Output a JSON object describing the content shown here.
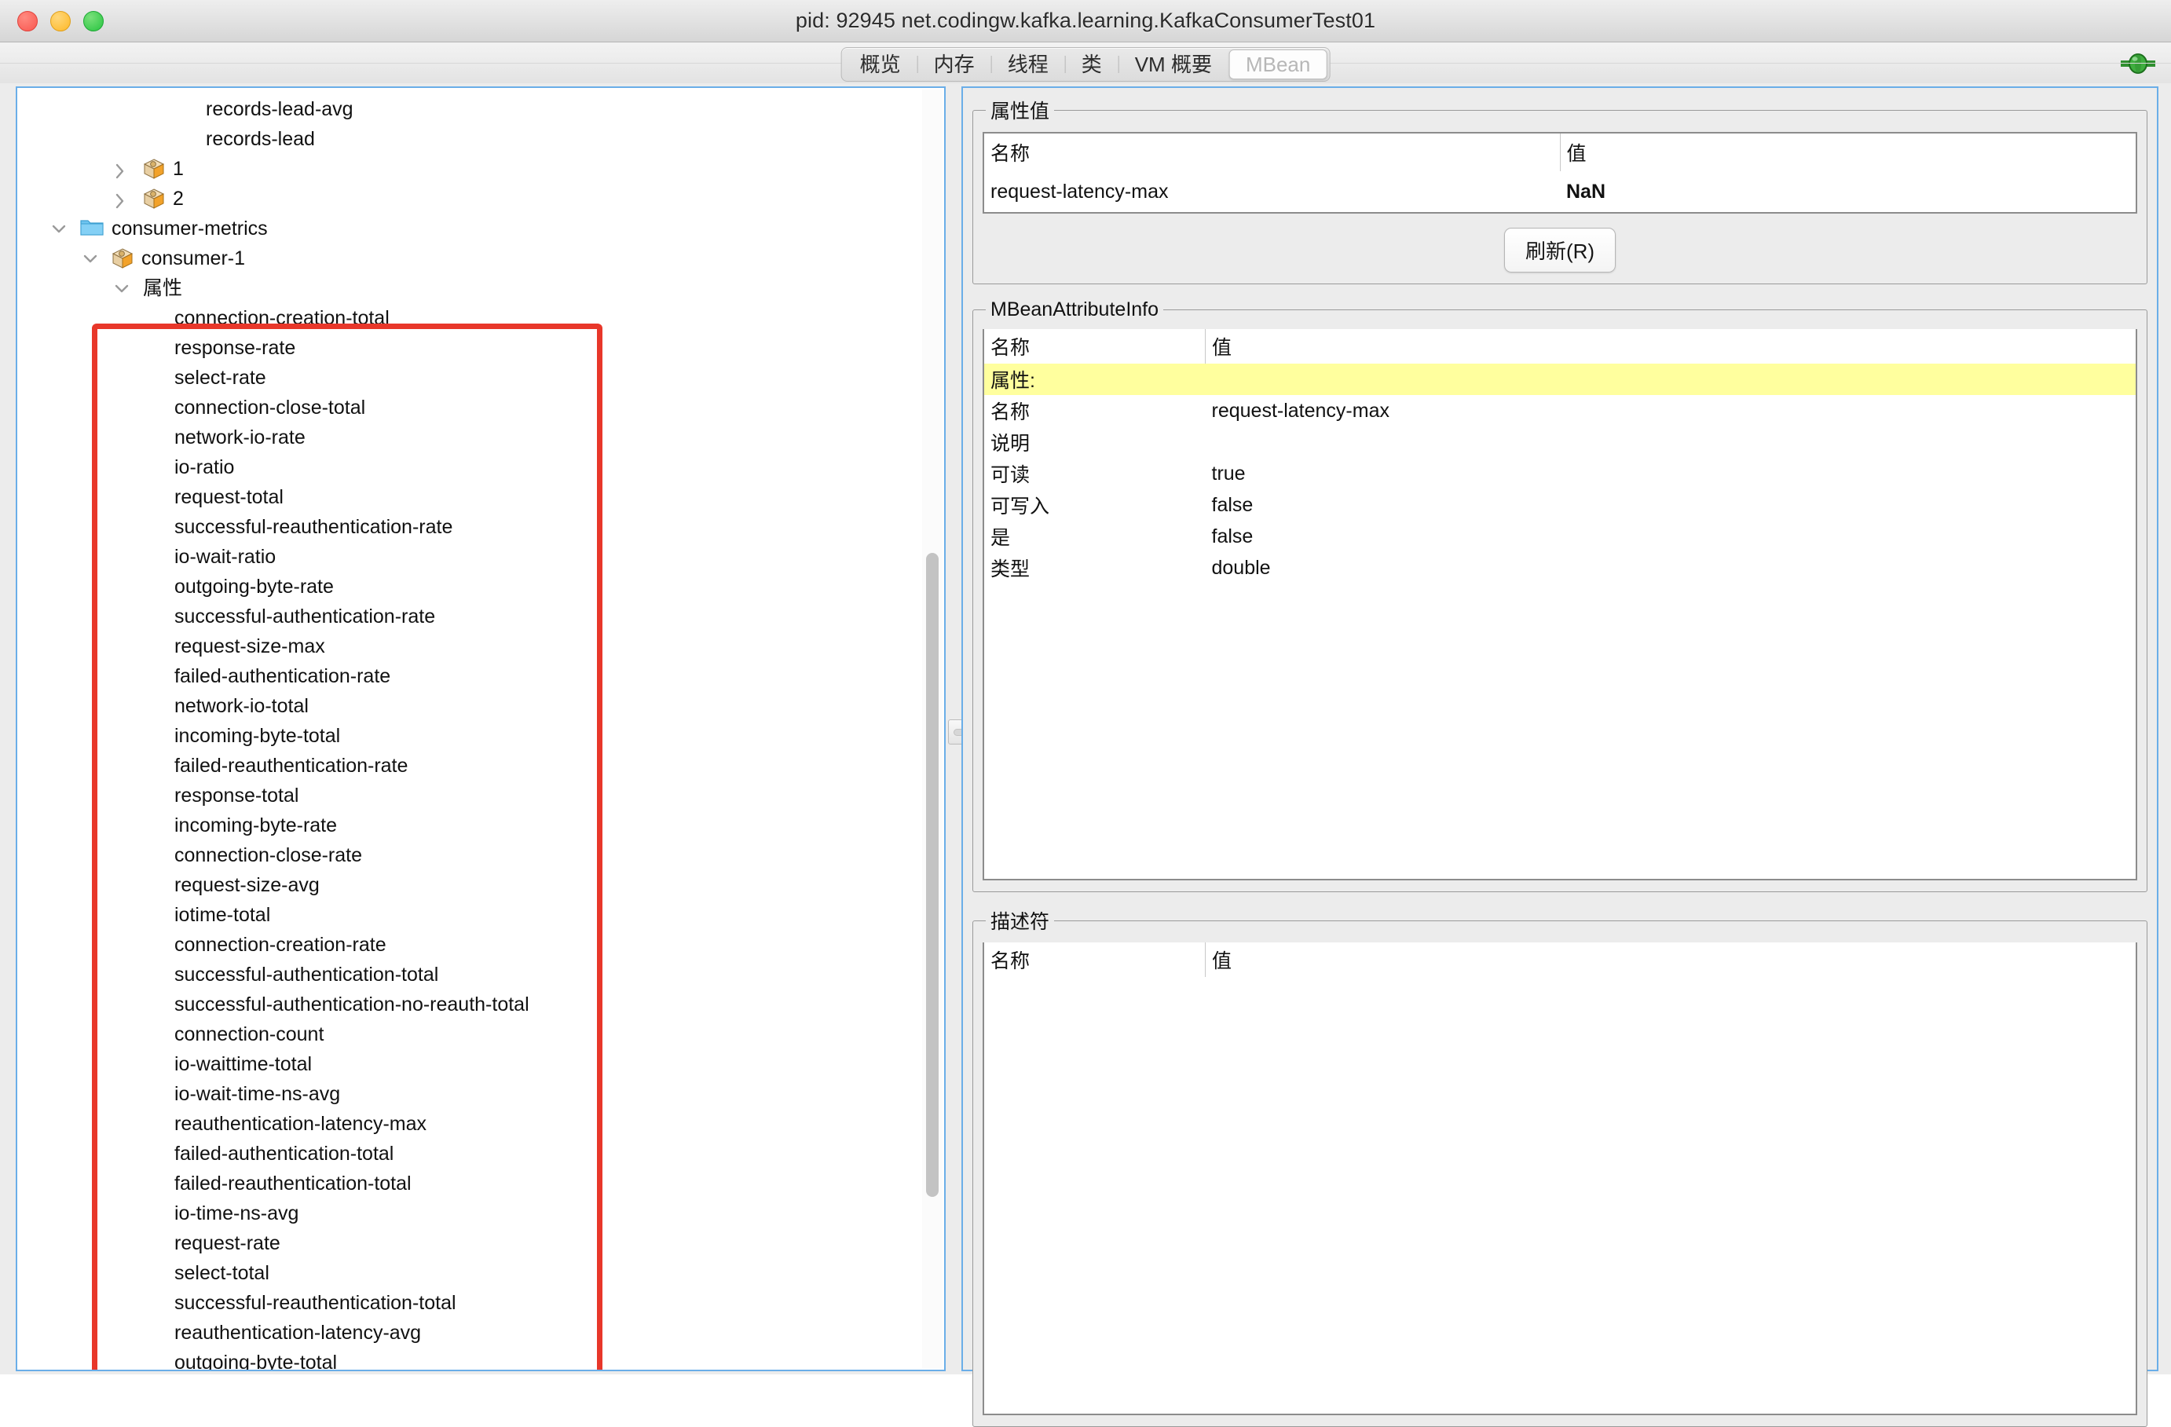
{
  "window": {
    "title": "pid: 92945 net.codingw.kafka.learning.KafkaConsumerTest01",
    "traffic_lights": [
      "close-button",
      "minimize-button",
      "zoom-button"
    ]
  },
  "toolbar": {
    "tabs": [
      {
        "label": "概览",
        "selected": false
      },
      {
        "label": "内存",
        "selected": false
      },
      {
        "label": "线程",
        "selected": false
      },
      {
        "label": "类",
        "selected": false
      },
      {
        "label": "VM 概要",
        "selected": false
      },
      {
        "label": "MBean",
        "selected": true
      }
    ],
    "connection_icon": "plug-connected-icon",
    "connection_color": "#2f9e2f"
  },
  "tree": {
    "rows": [
      {
        "label": "records-lead-avg",
        "indent": 5,
        "twisty": "none",
        "icon": "none"
      },
      {
        "label": "records-lead",
        "indent": 5,
        "twisty": "none",
        "icon": "none"
      },
      {
        "label": "1",
        "indent": 3,
        "twisty": "collapsed",
        "icon": "mbean-cube-icon"
      },
      {
        "label": "2",
        "indent": 3,
        "twisty": "collapsed",
        "icon": "mbean-cube-icon"
      },
      {
        "label": "consumer-metrics",
        "indent": 1,
        "twisty": "expanded",
        "icon": "folder-icon"
      },
      {
        "label": "consumer-1",
        "indent": 2,
        "twisty": "expanded",
        "icon": "mbean-cube-icon"
      },
      {
        "label": "属性",
        "indent": 3,
        "twisty": "expanded",
        "icon": "none"
      },
      {
        "label": "connection-creation-total",
        "indent": 4,
        "twisty": "none",
        "icon": "none"
      },
      {
        "label": "response-rate",
        "indent": 4,
        "twisty": "none",
        "icon": "none"
      },
      {
        "label": "select-rate",
        "indent": 4,
        "twisty": "none",
        "icon": "none"
      },
      {
        "label": "connection-close-total",
        "indent": 4,
        "twisty": "none",
        "icon": "none"
      },
      {
        "label": "network-io-rate",
        "indent": 4,
        "twisty": "none",
        "icon": "none"
      },
      {
        "label": "io-ratio",
        "indent": 4,
        "twisty": "none",
        "icon": "none"
      },
      {
        "label": "request-total",
        "indent": 4,
        "twisty": "none",
        "icon": "none"
      },
      {
        "label": "successful-reauthentication-rate",
        "indent": 4,
        "twisty": "none",
        "icon": "none"
      },
      {
        "label": "io-wait-ratio",
        "indent": 4,
        "twisty": "none",
        "icon": "none"
      },
      {
        "label": "outgoing-byte-rate",
        "indent": 4,
        "twisty": "none",
        "icon": "none"
      },
      {
        "label": "successful-authentication-rate",
        "indent": 4,
        "twisty": "none",
        "icon": "none"
      },
      {
        "label": "request-size-max",
        "indent": 4,
        "twisty": "none",
        "icon": "none"
      },
      {
        "label": "failed-authentication-rate",
        "indent": 4,
        "twisty": "none",
        "icon": "none"
      },
      {
        "label": "network-io-total",
        "indent": 4,
        "twisty": "none",
        "icon": "none"
      },
      {
        "label": "incoming-byte-total",
        "indent": 4,
        "twisty": "none",
        "icon": "none"
      },
      {
        "label": "failed-reauthentication-rate",
        "indent": 4,
        "twisty": "none",
        "icon": "none"
      },
      {
        "label": "response-total",
        "indent": 4,
        "twisty": "none",
        "icon": "none"
      },
      {
        "label": "incoming-byte-rate",
        "indent": 4,
        "twisty": "none",
        "icon": "none"
      },
      {
        "label": "connection-close-rate",
        "indent": 4,
        "twisty": "none",
        "icon": "none"
      },
      {
        "label": "request-size-avg",
        "indent": 4,
        "twisty": "none",
        "icon": "none"
      },
      {
        "label": "iotime-total",
        "indent": 4,
        "twisty": "none",
        "icon": "none"
      },
      {
        "label": "connection-creation-rate",
        "indent": 4,
        "twisty": "none",
        "icon": "none"
      },
      {
        "label": "successful-authentication-total",
        "indent": 4,
        "twisty": "none",
        "icon": "none"
      },
      {
        "label": "successful-authentication-no-reauth-total",
        "indent": 4,
        "twisty": "none",
        "icon": "none"
      },
      {
        "label": "connection-count",
        "indent": 4,
        "twisty": "none",
        "icon": "none"
      },
      {
        "label": "io-waittime-total",
        "indent": 4,
        "twisty": "none",
        "icon": "none"
      },
      {
        "label": "io-wait-time-ns-avg",
        "indent": 4,
        "twisty": "none",
        "icon": "none"
      },
      {
        "label": "reauthentication-latency-max",
        "indent": 4,
        "twisty": "none",
        "icon": "none"
      },
      {
        "label": "failed-authentication-total",
        "indent": 4,
        "twisty": "none",
        "icon": "none"
      },
      {
        "label": "failed-reauthentication-total",
        "indent": 4,
        "twisty": "none",
        "icon": "none"
      },
      {
        "label": "io-time-ns-avg",
        "indent": 4,
        "twisty": "none",
        "icon": "none"
      },
      {
        "label": "request-rate",
        "indent": 4,
        "twisty": "none",
        "icon": "none"
      },
      {
        "label": "select-total",
        "indent": 4,
        "twisty": "none",
        "icon": "none"
      },
      {
        "label": "successful-reauthentication-total",
        "indent": 4,
        "twisty": "none",
        "icon": "none"
      },
      {
        "label": "reauthentication-latency-avg",
        "indent": 4,
        "twisty": "none",
        "icon": "none"
      },
      {
        "label": "outgoing-byte-total",
        "indent": 4,
        "twisty": "none",
        "icon": "none"
      }
    ],
    "annotation": {
      "shape": "rectangle",
      "color": "#e8372a"
    }
  },
  "attr_value": {
    "legend": "属性值",
    "columns": [
      "名称",
      "值"
    ],
    "rows": [
      {
        "name": "request-latency-max",
        "value": "NaN"
      }
    ],
    "refresh_button": "刷新(R)"
  },
  "mbean_attr_info": {
    "legend": "MBeanAttributeInfo",
    "columns": [
      "名称",
      "值"
    ],
    "rows": [
      {
        "name": "属性:",
        "value": "",
        "highlight": true
      },
      {
        "name": "名称",
        "value": "request-latency-max",
        "highlight": false
      },
      {
        "name": "说明",
        "value": "",
        "highlight": false
      },
      {
        "name": "可读",
        "value": "true",
        "highlight": false
      },
      {
        "name": "可写入",
        "value": "false",
        "highlight": false
      },
      {
        "name": "是",
        "value": "false",
        "highlight": false
      },
      {
        "name": "类型",
        "value": "double",
        "highlight": false
      }
    ],
    "highlight_color": "#ffff9e"
  },
  "descriptor": {
    "legend": "描述符",
    "columns": [
      "名称",
      "值"
    ],
    "rows": []
  }
}
